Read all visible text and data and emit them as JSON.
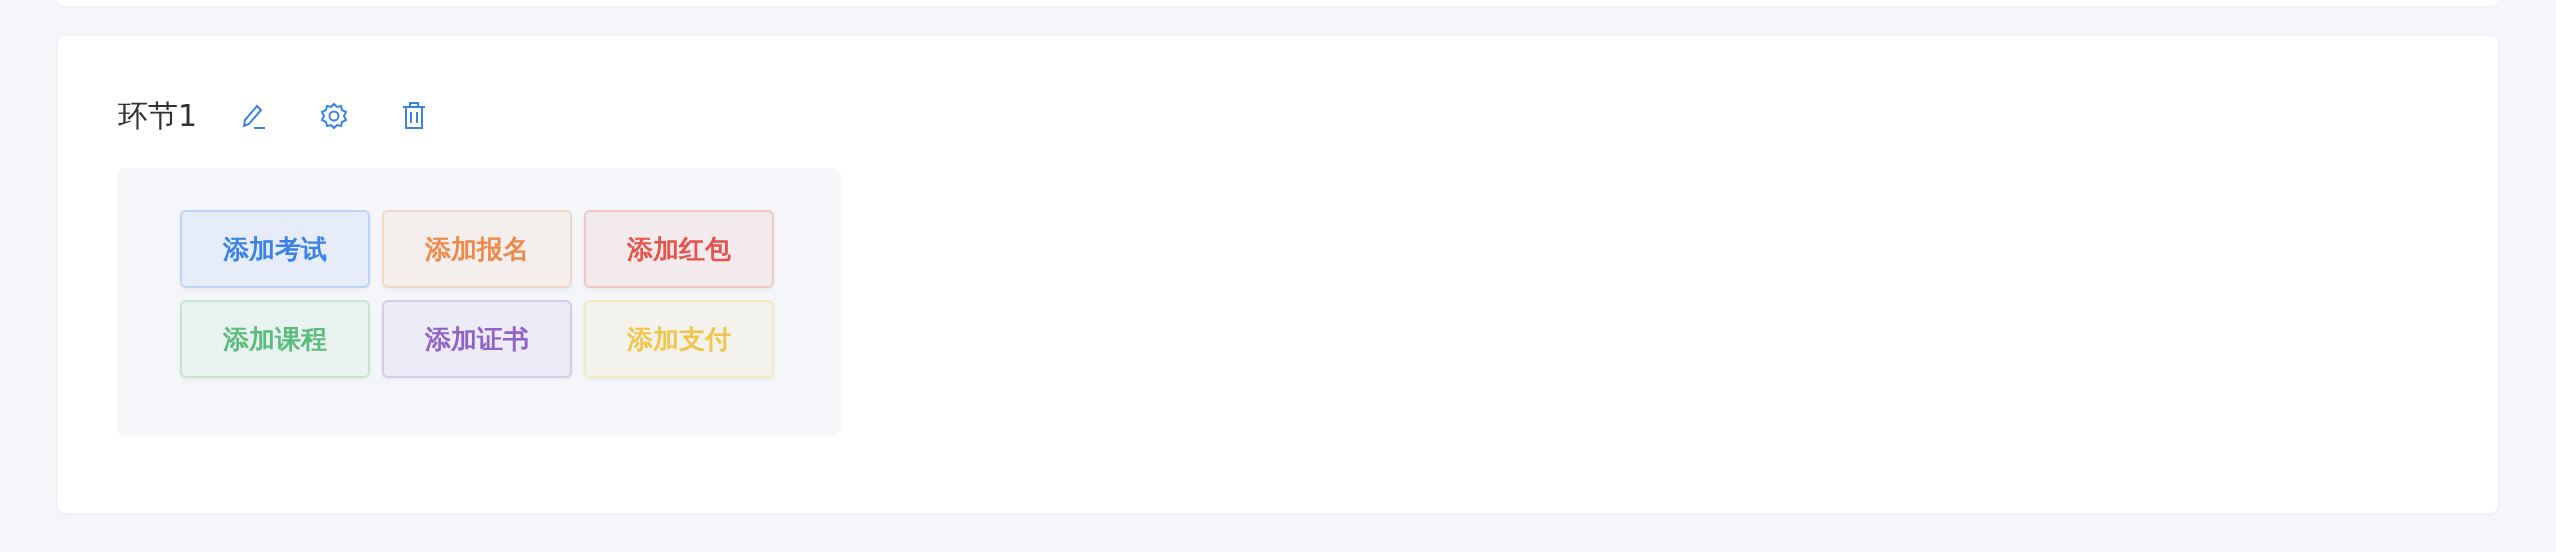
{
  "section": {
    "title": "环节1",
    "actions": [
      {
        "kind": "edit"
      },
      {
        "kind": "settings"
      },
      {
        "kind": "delete"
      }
    ],
    "buttons": [
      {
        "label": "添加考试",
        "color": "#3b82e6"
      },
      {
        "label": "添加报名",
        "color": "#eb8a4a"
      },
      {
        "label": "添加红包",
        "color": "#e5534b"
      },
      {
        "label": "添加课程",
        "color": "#5bbd7c"
      },
      {
        "label": "添加证书",
        "color": "#9063c8"
      },
      {
        "label": "添加支付",
        "color": "#f0c64a"
      }
    ]
  }
}
